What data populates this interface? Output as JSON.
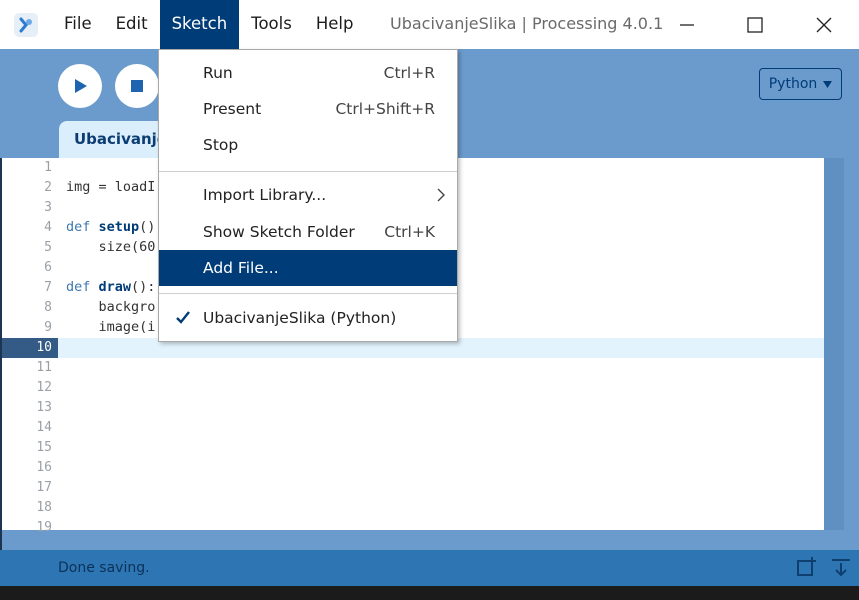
{
  "window": {
    "title": "UbacivanjeSlika | Processing 4.0.1"
  },
  "menubar": {
    "items": [
      "File",
      "Edit",
      "Sketch",
      "Tools",
      "Help"
    ],
    "active": "Sketch"
  },
  "toolbar": {
    "run_icon": "play-icon",
    "stop_icon": "stop-icon",
    "mode_label": "Python"
  },
  "tabs": [
    {
      "label": "UbacivanjeSlika"
    }
  ],
  "editor": {
    "line_numbers": [
      "1",
      "2",
      "3",
      "4",
      "5",
      "6",
      "7",
      "8",
      "9",
      "10",
      "11",
      "12",
      "13",
      "14",
      "15",
      "16",
      "17",
      "18",
      "19"
    ],
    "current_line": 10,
    "code": [
      {
        "line": 2,
        "kw": "",
        "fn": "",
        "rest": "img = loadI"
      },
      {
        "line": 4,
        "kw": "def ",
        "fn": "setup",
        "rest": "()"
      },
      {
        "line": 5,
        "kw": "",
        "fn": "",
        "rest": "    size(60"
      },
      {
        "line": 7,
        "kw": "def ",
        "fn": "draw",
        "rest": "():"
      },
      {
        "line": 8,
        "kw": "",
        "fn": "",
        "rest": "    backgro"
      },
      {
        "line": 9,
        "kw": "",
        "fn": "",
        "rest": "    image(i"
      }
    ]
  },
  "status": {
    "message": "Done saving."
  },
  "sketch_menu": {
    "run": {
      "label": "Run",
      "shortcut": "Ctrl+R"
    },
    "present": {
      "label": "Present",
      "shortcut": "Ctrl+Shift+R"
    },
    "stop": {
      "label": "Stop",
      "shortcut": ""
    },
    "import_library": {
      "label": "Import Library..."
    },
    "show_folder": {
      "label": "Show Sketch Folder",
      "shortcut": "Ctrl+K"
    },
    "add_file": {
      "label": "Add File..."
    },
    "current_sketch": {
      "label": "UbacivanjeSlika (Python)"
    }
  },
  "colors": {
    "accent": "#003c78",
    "toolbar": "#6b9bcc",
    "status_bar": "#2d76b3",
    "current_line": "#e3f3fd"
  }
}
